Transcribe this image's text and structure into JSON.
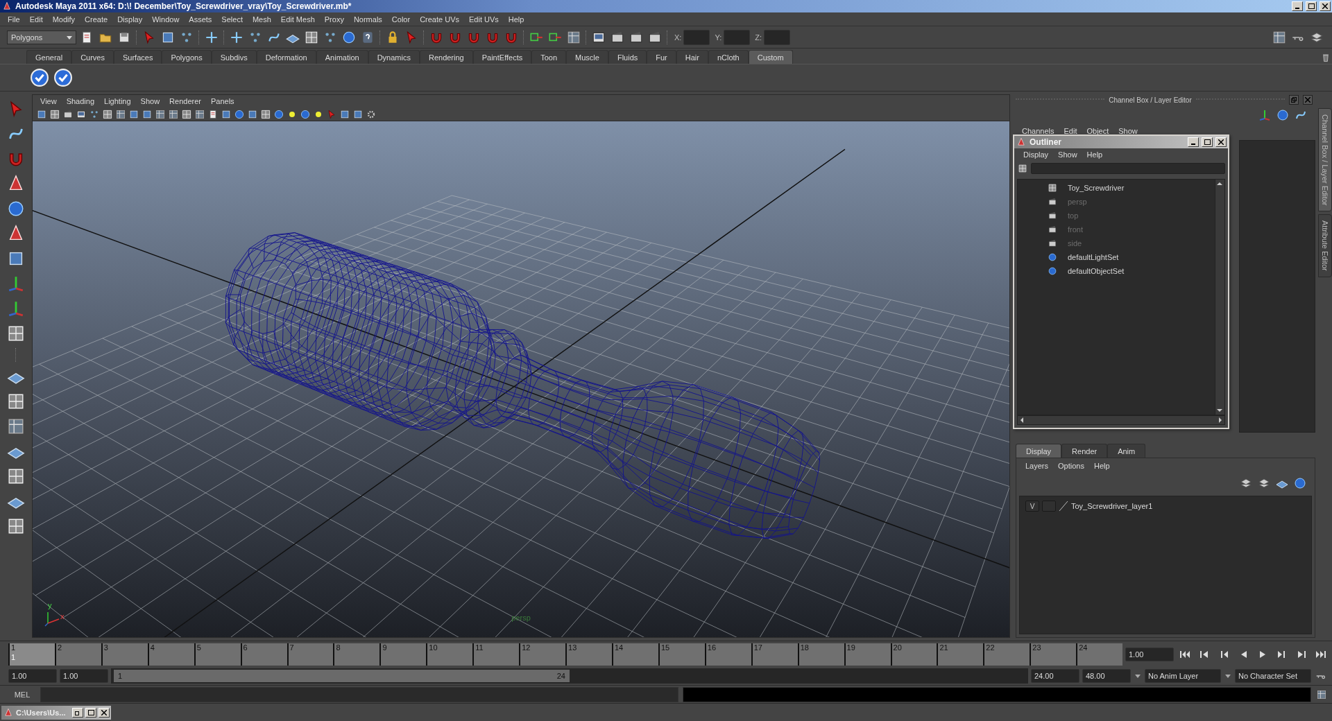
{
  "window": {
    "title": "Autodesk Maya 2011 x64: D:\\! December\\Toy_Screwdriver_vray\\Toy_Screwdriver.mb*"
  },
  "menu_bar": [
    "File",
    "Edit",
    "Modify",
    "Create",
    "Display",
    "Window",
    "Assets",
    "Select",
    "Mesh",
    "Edit Mesh",
    "Proxy",
    "Normals",
    "Color",
    "Create UVs",
    "Edit UVs",
    "Help"
  ],
  "toolbar": {
    "mode": "Polygons",
    "coords": [
      "X:",
      "Y:",
      "Z:"
    ]
  },
  "shelf_tabs": [
    {
      "label": "General",
      "selected": false
    },
    {
      "label": "Curves",
      "selected": false
    },
    {
      "label": "Surfaces",
      "selected": false
    },
    {
      "label": "Polygons",
      "selected": false
    },
    {
      "label": "Subdivs",
      "selected": false
    },
    {
      "label": "Deformation",
      "selected": false
    },
    {
      "label": "Animation",
      "selected": false
    },
    {
      "label": "Dynamics",
      "selected": false
    },
    {
      "label": "Rendering",
      "selected": false
    },
    {
      "label": "PaintEffects",
      "selected": false
    },
    {
      "label": "Toon",
      "selected": false
    },
    {
      "label": "Muscle",
      "selected": false
    },
    {
      "label": "Fluids",
      "selected": false
    },
    {
      "label": "Fur",
      "selected": false
    },
    {
      "label": "Hair",
      "selected": false
    },
    {
      "label": "nCloth",
      "selected": false
    },
    {
      "label": "Custom",
      "selected": true
    }
  ],
  "viewport": {
    "menu": [
      "View",
      "Shading",
      "Lighting",
      "Show",
      "Renderer",
      "Panels"
    ],
    "camera": "persp",
    "axes": [
      "y",
      "x"
    ]
  },
  "channel_box": {
    "title": "Channel Box / Layer Editor",
    "menu": [
      "Channels",
      "Edit",
      "Object",
      "Show"
    ],
    "side_tabs": [
      "Channel Box / Layer Editor",
      "Attribute Editor"
    ]
  },
  "outliner": {
    "title": "Outliner",
    "menu": [
      "Display",
      "Show",
      "Help"
    ],
    "items": [
      {
        "label": "Toy_Screwdriver",
        "kind": "mesh",
        "greyed": false
      },
      {
        "label": "persp",
        "kind": "camera",
        "greyed": true
      },
      {
        "label": "top",
        "kind": "camera",
        "greyed": true
      },
      {
        "label": "front",
        "kind": "camera",
        "greyed": true
      },
      {
        "label": "side",
        "kind": "camera",
        "greyed": true
      },
      {
        "label": "defaultLightSet",
        "kind": "set",
        "greyed": false
      },
      {
        "label": "defaultObjectSet",
        "kind": "set",
        "greyed": false
      }
    ]
  },
  "layer_editor": {
    "tabs": [
      {
        "label": "Display",
        "selected": true
      },
      {
        "label": "Render",
        "selected": false
      },
      {
        "label": "Anim",
        "selected": false
      }
    ],
    "menu": [
      "Layers",
      "Options",
      "Help"
    ],
    "layers": [
      {
        "visibility": "V",
        "name": "Toy_Screwdriver_layer1"
      }
    ]
  },
  "timeline": {
    "ticks": [
      {
        "label": "1",
        "selected": true
      },
      {
        "label": "2",
        "selected": false
      },
      {
        "label": "3",
        "selected": false
      },
      {
        "label": "4",
        "selected": false
      },
      {
        "label": "5",
        "selected": false
      },
      {
        "label": "6",
        "selected": false
      },
      {
        "label": "7",
        "selected": false
      },
      {
        "label": "8",
        "selected": false
      },
      {
        "label": "9",
        "selected": false
      },
      {
        "label": "10",
        "selected": false
      },
      {
        "label": "11",
        "selected": false
      },
      {
        "label": "12",
        "selected": false
      },
      {
        "label": "13",
        "selected": false
      },
      {
        "label": "14",
        "selected": false
      },
      {
        "label": "15",
        "selected": false
      },
      {
        "label": "16",
        "selected": false
      },
      {
        "label": "17",
        "selected": false
      },
      {
        "label": "18",
        "selected": false
      },
      {
        "label": "19",
        "selected": false
      },
      {
        "label": "20",
        "selected": false
      },
      {
        "label": "21",
        "selected": false
      },
      {
        "label": "22",
        "selected": false
      },
      {
        "label": "23",
        "selected": false
      },
      {
        "label": "24",
        "selected": false
      }
    ],
    "current_frame": "1",
    "current_time": "1.00"
  },
  "range": {
    "start": "1.00",
    "playback_start": "1.00",
    "slider_start": "1",
    "slider_end": "24",
    "level": 0.5,
    "playback_end": "24.00",
    "end": "48.00",
    "anim_layer": "No Anim Layer",
    "character_set": "No Character Set"
  },
  "command_line": {
    "label": "MEL"
  },
  "taskbar": {
    "window": "C:\\Users\\Us..."
  }
}
